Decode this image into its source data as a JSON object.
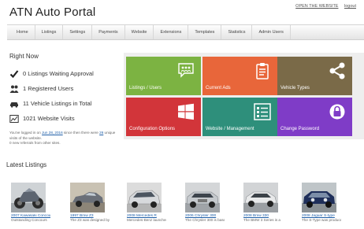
{
  "header": {
    "title": "ATN Auto Portal",
    "open_site": "OPEN THE WEBSITE",
    "logout": "logout"
  },
  "nav": [
    "Home",
    "Listings",
    "Settings",
    "Payments",
    "Website",
    "Extensions",
    "Templates",
    "Statistics",
    "Admin Users"
  ],
  "stats": {
    "heading": "Right Now",
    "items": [
      {
        "text": "0 Listings Waiting Approval",
        "icon": "checkmark-icon"
      },
      {
        "text": "1 Registered Users",
        "icon": "users-icon"
      },
      {
        "text": "11 Vehicle Listings in Total",
        "icon": "car-icon"
      },
      {
        "text": "1021 Website Visits",
        "icon": "chart-icon"
      }
    ],
    "login_note": {
      "p1": "You've logged in on ",
      "date": "Jun 28, 2016",
      "p2": " since then there were ",
      "count": "26",
      "p3": " unique visits of the website.",
      "p4": "0 new referrals from other sites."
    }
  },
  "tiles": [
    {
      "label": "Listings / Users",
      "color": "#7cb342",
      "icon": "users-icon"
    },
    {
      "label": "Current Ads",
      "color": "#e8663a",
      "icon": "clipboard-icon"
    },
    {
      "label": "Vehicle Types",
      "color": "#7a6a48",
      "icon": "share-icon"
    },
    {
      "label": "Configuration Options",
      "color": "#d2353a",
      "icon": "windows-icon"
    },
    {
      "label": "Website / Management",
      "color": "#2e8f7b",
      "icon": "list-icon"
    },
    {
      "label": "Change Password",
      "color": "#7f3cc7",
      "icon": "lock-icon"
    }
  ],
  "latest": {
    "heading": "Latest Listings",
    "items": [
      {
        "title": "2007 Kawasaki Concours 14",
        "desc": "Outstanding Concours"
      },
      {
        "title": "1997 Bmw Z3",
        "desc": "The Z3 was designed by"
      },
      {
        "title": "2008 Mercedes R",
        "desc": "Mercedes-Benz launched"
      },
      {
        "title": "2006 Chrysler 300",
        "desc": "The Chrysler 300 is based"
      },
      {
        "title": "2008 Bmw 330",
        "desc": "The BMW 3 Series is a"
      },
      {
        "title": "2008 Jaguar S-type",
        "desc": "The S-Type was produced"
      }
    ]
  }
}
